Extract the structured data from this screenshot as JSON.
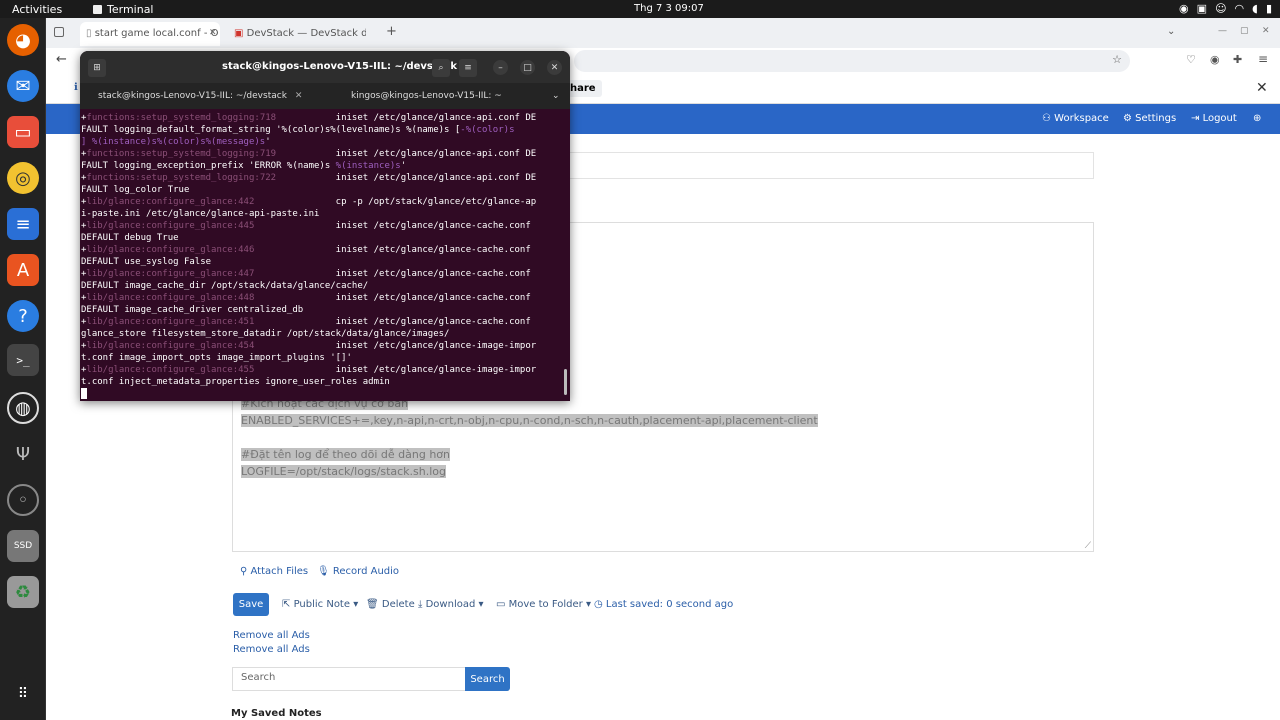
{
  "topbar": {
    "activities": "Activities",
    "app": "Terminal",
    "clock": "Thg 7 3  09:07"
  },
  "browser": {
    "tabs": [
      {
        "label": "start game local.conf - O"
      },
      {
        "label": "DevStack — DevStack do"
      }
    ],
    "infobar_text": "hare"
  },
  "site_nav": {
    "workspace": "Workspace",
    "settings": "Settings",
    "logout": "Logout"
  },
  "editor": {
    "lines": [
      "#Kích hoạt các dịch vụ cơ bản",
      "ENABLED_SERVICES+=,key,n-api,n-crt,n-obj,n-cpu,n-cond,n-sch,n-cauth,placement-api,placement-client",
      "",
      "#Đặt tên log để theo dõi dễ dàng hơn",
      "LOGFILE=/opt/stack/logs/stack.sh.log"
    ]
  },
  "tools": {
    "attach": "Attach Files",
    "record": "Record Audio"
  },
  "actions": {
    "save": "Save",
    "public_note": "Public Note",
    "delete": "Delete",
    "download": "Download",
    "move": "Move to Folder",
    "last_saved": "Last saved: 0 second ago"
  },
  "links": [
    "Remove all Ads",
    "Remove all Ads"
  ],
  "search": {
    "placeholder": "Search",
    "button": "Search"
  },
  "saved_heading": "My Saved Notes",
  "terminal": {
    "title": "stack@kingos-Lenovo-V15-IIL: ~/devstack",
    "tabs": [
      "stack@kingos-Lenovo-V15-IIL: ~/devstack",
      "kingos@kingos-Lenovo-V15-IIL: ~"
    ],
    "lines": [
      [
        {
          "t": "+",
          "c": ""
        },
        {
          "t": "functions:setup_systemd_logging:718",
          "c": "d"
        },
        {
          "t": "           iniset /etc/glance/glance-api.conf DE",
          "c": ""
        }
      ],
      [
        {
          "t": "FAULT logging_default_format_string '%(color)s%(levelname)s %(name)s [",
          "c": ""
        },
        {
          "t": "-%(color)s",
          "c": "p"
        }
      ],
      [
        {
          "t": "] %(instance)s%(color)s%(message)s",
          "c": "p"
        },
        {
          "t": "'",
          "c": ""
        }
      ],
      [
        {
          "t": "+",
          "c": ""
        },
        {
          "t": "functions:setup_systemd_logging:719",
          "c": "d"
        },
        {
          "t": "           iniset /etc/glance/glance-api.conf DE",
          "c": ""
        }
      ],
      [
        {
          "t": "FAULT logging_exception_prefix 'ERROR %(name)s ",
          "c": ""
        },
        {
          "t": "%(instance)s",
          "c": "p"
        },
        {
          "t": "'",
          "c": ""
        }
      ],
      [
        {
          "t": "+",
          "c": ""
        },
        {
          "t": "functions:setup_systemd_logging:722",
          "c": "d"
        },
        {
          "t": "           iniset /etc/glance/glance-api.conf DE",
          "c": ""
        }
      ],
      [
        {
          "t": "FAULT log_color True",
          "c": ""
        }
      ],
      [
        {
          "t": "+",
          "c": ""
        },
        {
          "t": "lib/glance:configure_glance:442",
          "c": "d"
        },
        {
          "t": "               cp -p /opt/stack/glance/etc/glance-ap",
          "c": ""
        }
      ],
      [
        {
          "t": "i-paste.ini /etc/glance/glance-api-paste.ini",
          "c": ""
        }
      ],
      [
        {
          "t": "+",
          "c": ""
        },
        {
          "t": "lib/glance:configure_glance:445",
          "c": "d"
        },
        {
          "t": "               iniset /etc/glance/glance-cache.conf",
          "c": ""
        }
      ],
      [
        {
          "t": "DEFAULT debug True",
          "c": ""
        }
      ],
      [
        {
          "t": "+",
          "c": ""
        },
        {
          "t": "lib/glance:configure_glance:446",
          "c": "d"
        },
        {
          "t": "               iniset /etc/glance/glance-cache.conf",
          "c": ""
        }
      ],
      [
        {
          "t": "DEFAULT use_syslog False",
          "c": ""
        }
      ],
      [
        {
          "t": "+",
          "c": ""
        },
        {
          "t": "lib/glance:configure_glance:447",
          "c": "d"
        },
        {
          "t": "               iniset /etc/glance/glance-cache.conf",
          "c": ""
        }
      ],
      [
        {
          "t": "DEFAULT image_cache_dir /opt/stack/data/glance/cache/",
          "c": ""
        }
      ],
      [
        {
          "t": "+",
          "c": ""
        },
        {
          "t": "lib/glance:configure_glance:448",
          "c": "d"
        },
        {
          "t": "               iniset /etc/glance/glance-cache.conf",
          "c": ""
        }
      ],
      [
        {
          "t": "DEFAULT image_cache_driver centralized_db",
          "c": ""
        }
      ],
      [
        {
          "t": "+",
          "c": ""
        },
        {
          "t": "lib/glance:configure_glance:451",
          "c": "d"
        },
        {
          "t": "               iniset /etc/glance/glance-cache.conf",
          "c": ""
        }
      ],
      [
        {
          "t": "glance_store filesystem_store_datadir /opt/stack/data/glance/images/",
          "c": ""
        }
      ],
      [
        {
          "t": "+",
          "c": ""
        },
        {
          "t": "lib/glance:configure_glance:454",
          "c": "d"
        },
        {
          "t": "               iniset /etc/glance/glance-image-impor",
          "c": ""
        }
      ],
      [
        {
          "t": "t.conf image_import_opts image_import_plugins '[]'",
          "c": ""
        }
      ],
      [
        {
          "t": "+",
          "c": ""
        },
        {
          "t": "lib/glance:configure_glance:455",
          "c": "d"
        },
        {
          "t": "               iniset /etc/glance/glance-image-impor",
          "c": ""
        }
      ],
      [
        {
          "t": "t.conf inject_metadata_properties ignore_user_roles admin",
          "c": ""
        }
      ]
    ]
  },
  "colors": {
    "nav": "#2a66c6",
    "button": "#2f73c5",
    "terminal_bg": "#300a24"
  }
}
